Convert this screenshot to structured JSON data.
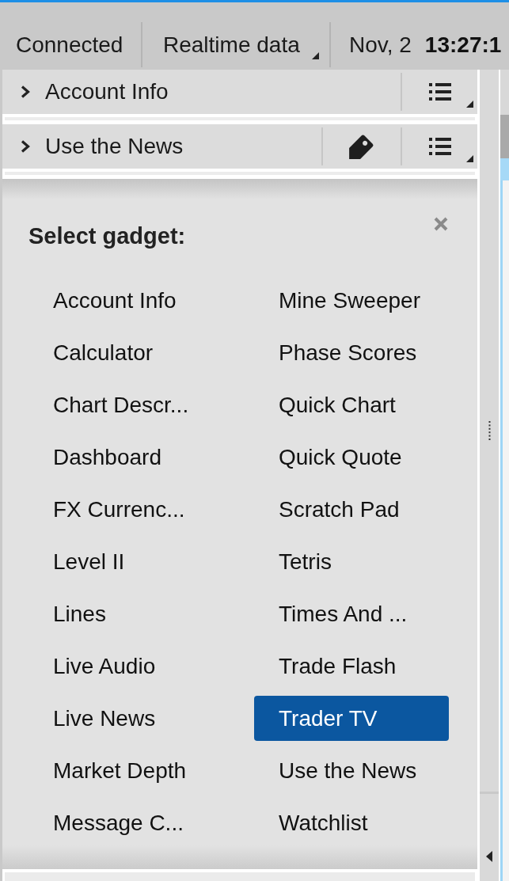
{
  "status_bar": {
    "connection": "Connected",
    "data_feed": "Realtime data",
    "date": "Nov, 2",
    "time": "13:27:1"
  },
  "gadgets": [
    {
      "title": "Account Info",
      "expanded": false,
      "actions": [
        {
          "kind": "menu"
        }
      ]
    },
    {
      "title": "Use the News",
      "expanded": false,
      "actions": [
        {
          "kind": "tag"
        },
        {
          "kind": "menu"
        }
      ]
    }
  ],
  "gadget_picker": {
    "title": "Select gadget:",
    "items": [
      {
        "label": "Account Info",
        "selected": false
      },
      {
        "label": "Calculator",
        "selected": false
      },
      {
        "label": "Chart Descr...",
        "selected": false
      },
      {
        "label": "Dashboard",
        "selected": false
      },
      {
        "label": "FX Currenc...",
        "selected": false
      },
      {
        "label": "Level II",
        "selected": false
      },
      {
        "label": "Lines",
        "selected": false
      },
      {
        "label": "Live Audio",
        "selected": false
      },
      {
        "label": "Live News",
        "selected": false
      },
      {
        "label": "Market Depth",
        "selected": false
      },
      {
        "label": "Message C...",
        "selected": false
      },
      {
        "label": "Mine Sweeper",
        "selected": false
      },
      {
        "label": "Phase Scores",
        "selected": false
      },
      {
        "label": "Quick Chart",
        "selected": false
      },
      {
        "label": "Quick Quote",
        "selected": false
      },
      {
        "label": "Scratch Pad",
        "selected": false
      },
      {
        "label": "Tetris",
        "selected": false
      },
      {
        "label": "Times And ...",
        "selected": false
      },
      {
        "label": "Trade Flash",
        "selected": false
      },
      {
        "label": "Trader TV",
        "selected": true
      },
      {
        "label": "Use the News",
        "selected": false
      },
      {
        "label": "Watchlist",
        "selected": false
      }
    ]
  }
}
